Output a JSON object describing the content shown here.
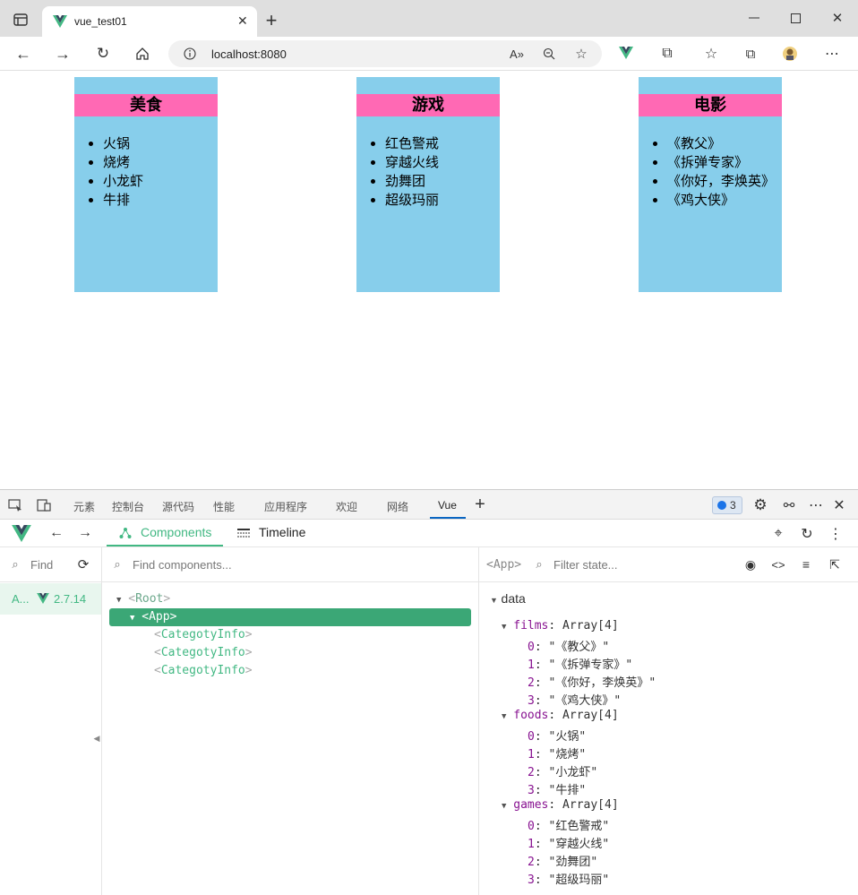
{
  "browser": {
    "tab_title": "vue_test01",
    "url": "localhost:8080"
  },
  "cards": [
    {
      "title": "美食",
      "items": [
        "火锅",
        "烧烤",
        "小龙虾",
        "牛排"
      ]
    },
    {
      "title": "游戏",
      "items": [
        "红色警戒",
        "穿越火线",
        "劲舞团",
        "超级玛丽"
      ]
    },
    {
      "title": "电影",
      "items": [
        "《教父》",
        "《拆弹专家》",
        "《你好，李焕英》",
        "《鸡大侠》"
      ]
    }
  ],
  "devtools": {
    "tabs": [
      "元素",
      "控制台",
      "源代码",
      "性能",
      "应用程序",
      "欢迎",
      "网络",
      "Vue"
    ],
    "issues_count": "3"
  },
  "vue": {
    "tabs": {
      "components": "Components",
      "timeline": "Timeline"
    },
    "find_placeholder": "Find",
    "app_label": "A...",
    "version": "2.7.14",
    "find_components_placeholder": "Find components...",
    "tree": {
      "root": "Root",
      "app": "App",
      "child": "CategotyInfo"
    },
    "selected_component": "<App>",
    "filter_placeholder": "Filter state...",
    "state": {
      "section": "data",
      "arrays": [
        {
          "key": "films",
          "type": "Array[4]",
          "values": [
            "《教父》",
            "《拆弹专家》",
            "《你好，李焕英》",
            "《鸡大侠》"
          ]
        },
        {
          "key": "foods",
          "type": "Array[4]",
          "values": [
            "火锅",
            "烧烤",
            "小龙虾",
            "牛排"
          ]
        },
        {
          "key": "games",
          "type": "Array[4]",
          "values": [
            "红色警戒",
            "穿越火线",
            "劲舞团",
            "超级玛丽"
          ]
        }
      ]
    }
  },
  "colors": {
    "card_bg": "#87ceeb",
    "card_header": "#ff69b4",
    "vue_green": "#42b883",
    "selected_row": "#3ba776"
  }
}
